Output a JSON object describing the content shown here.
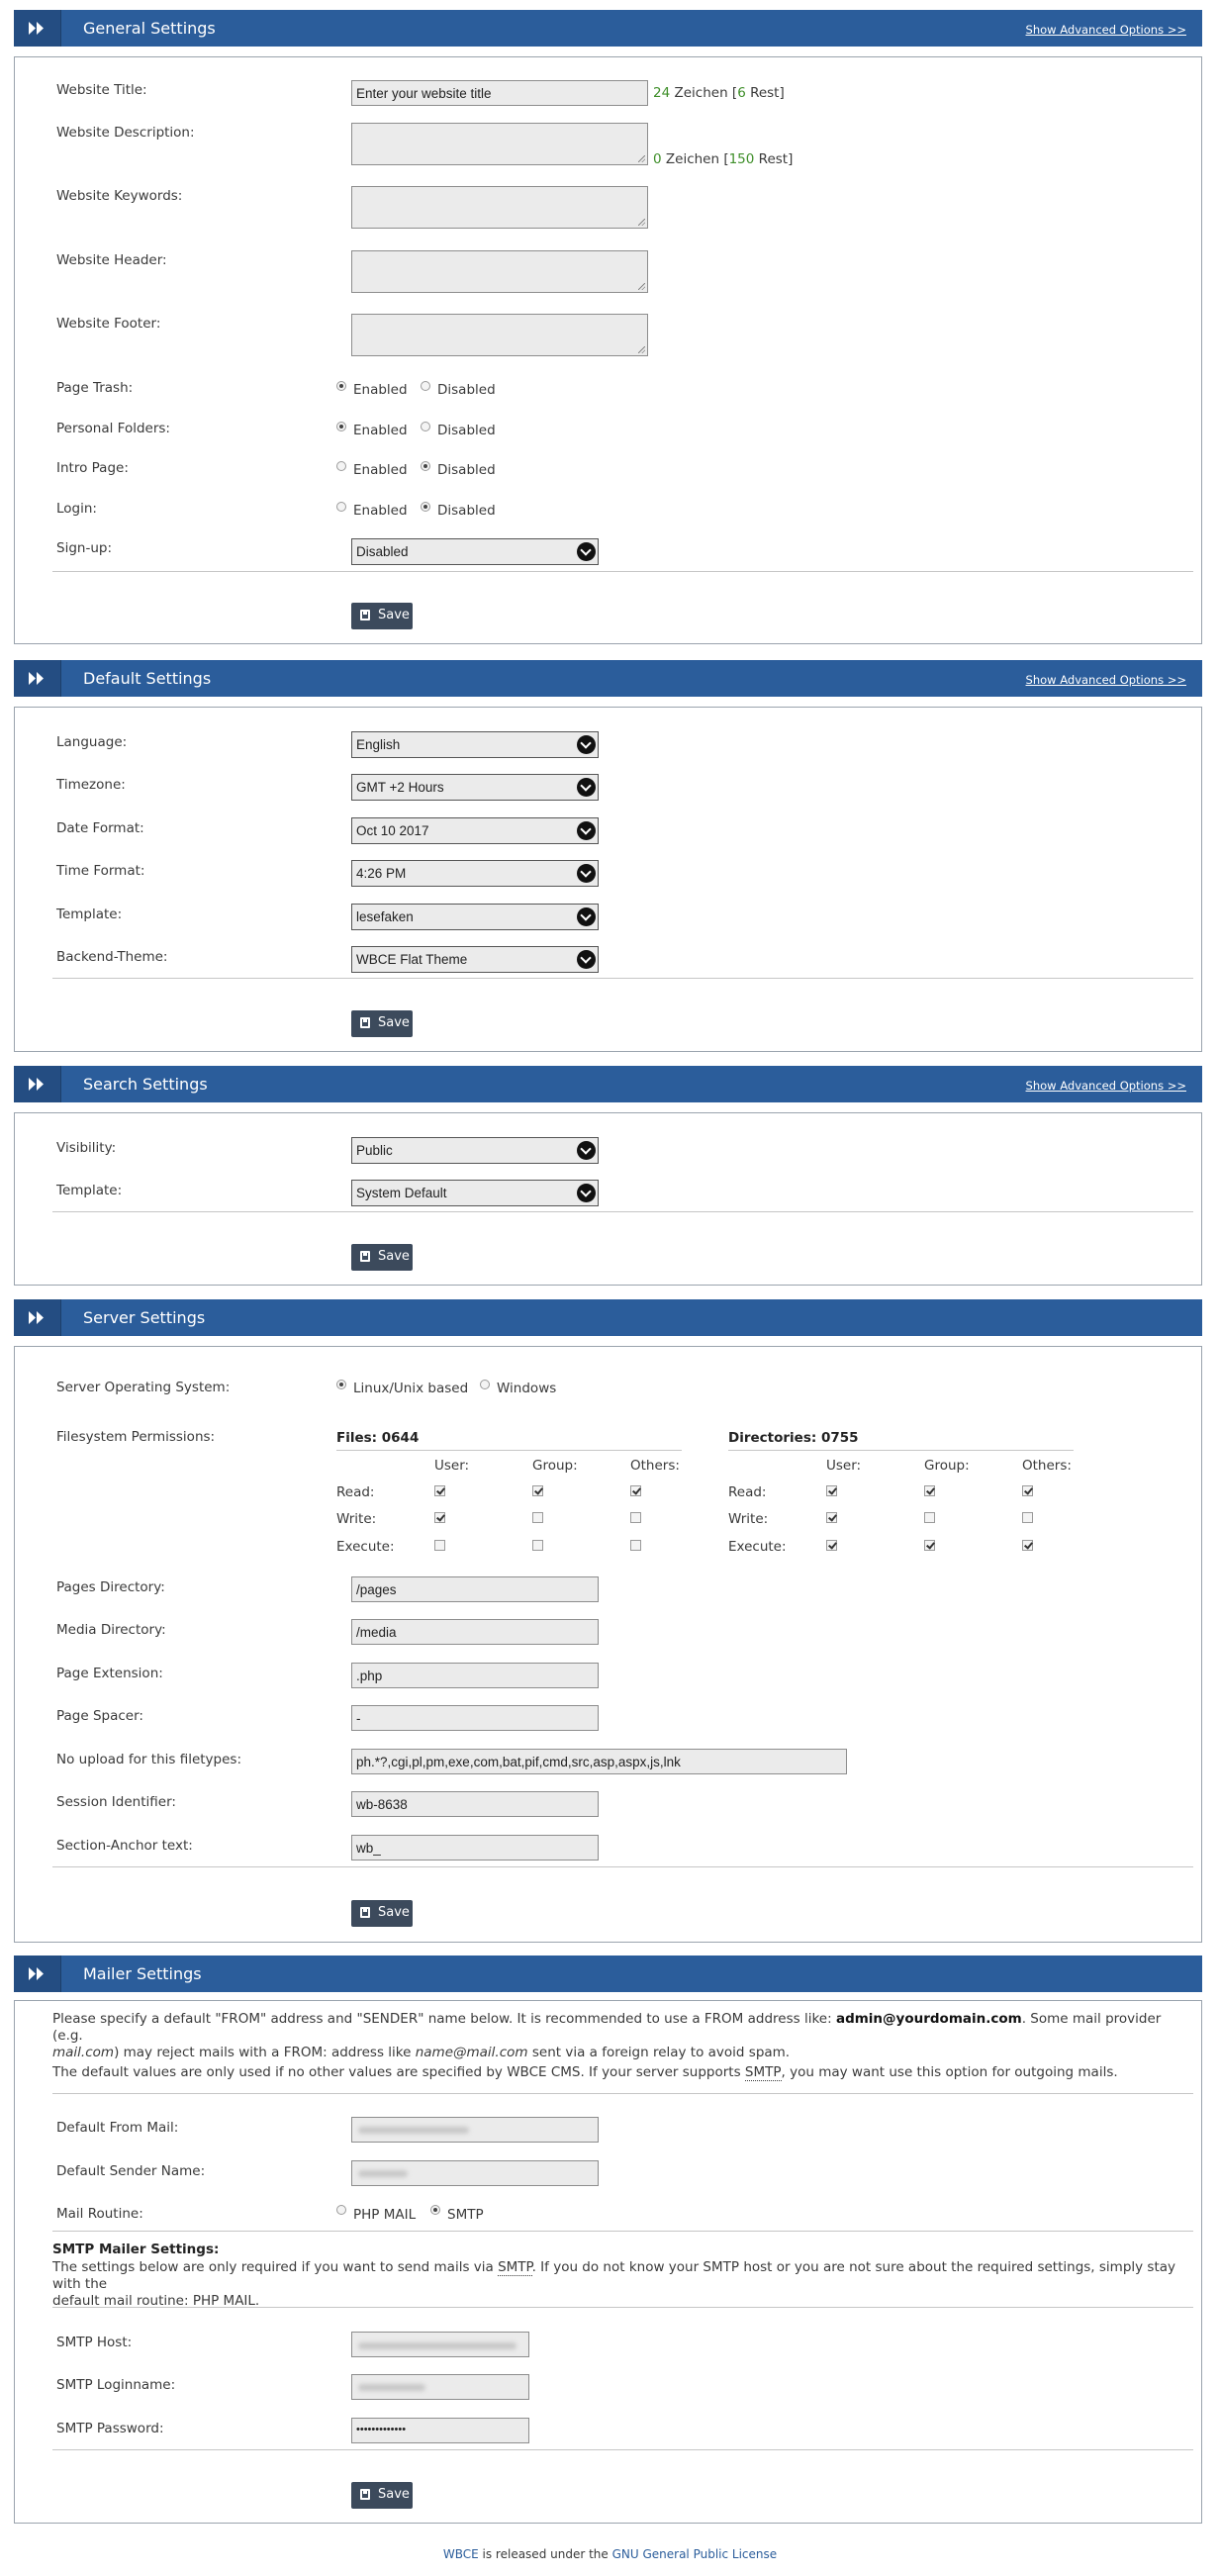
{
  "advanced_link": "Show Advanced Options >>",
  "save_label": "Save",
  "general": {
    "title": "General Settings",
    "website_title_label": "Website Title:",
    "website_title_value": "Enter your website title",
    "title_count": "24",
    "title_count_word": " Zeichen [",
    "title_rest": "6",
    "title_rest_word": " Rest]",
    "description_label": "Website Description:",
    "desc_count": "0",
    "desc_count_word": " Zeichen [",
    "desc_rest": "150",
    "desc_rest_word": " Rest]",
    "keywords_label": "Website Keywords:",
    "header_label": "Website Header:",
    "footer_label": "Website Footer:",
    "page_trash_label": "Page Trash:",
    "personal_folders_label": "Personal Folders:",
    "intro_page_label": "Intro Page:",
    "login_label": "Login:",
    "signup_label": "Sign-up:",
    "signup_value": "Disabled",
    "enabled": "Enabled",
    "disabled": "Disabled"
  },
  "default": {
    "title": "Default Settings",
    "language_label": "Language:",
    "language_value": "English",
    "timezone_label": "Timezone:",
    "timezone_value": "GMT +2 Hours",
    "date_format_label": "Date Format:",
    "date_format_value": "Oct 10 2017",
    "time_format_label": "Time Format:",
    "time_format_value": "4:26 PM",
    "template_label": "Template:",
    "template_value": "lesefaken",
    "backend_theme_label": "Backend-Theme:",
    "backend_theme_value": "WBCE Flat Theme"
  },
  "search": {
    "title": "Search Settings",
    "visibility_label": "Visibility:",
    "visibility_value": "Public",
    "template_label": "Template:",
    "template_value": "System Default"
  },
  "server": {
    "title": "Server Settings",
    "os_label": "Server Operating System:",
    "os_linux": "Linux/Unix based",
    "os_windows": "Windows",
    "fs_label": "Filesystem Permissions:",
    "files_header": "Files: 0644",
    "dirs_header": "Directories: 0755",
    "col_user": "User:",
    "col_group": "Group:",
    "col_others": "Others:",
    "row_read": "Read:",
    "row_write": "Write:",
    "row_execute": "Execute:",
    "pages_dir_label": "Pages Directory:",
    "pages_dir_value": "/pages",
    "media_dir_label": "Media Directory:",
    "media_dir_value": "/media",
    "page_ext_label": "Page Extension:",
    "page_ext_value": ".php",
    "page_spacer_label": "Page Spacer:",
    "page_spacer_value": "-",
    "no_upload_label": "No upload for this filetypes:",
    "no_upload_value": "ph.*?,cgi,pl,pm,exe,com,bat,pif,cmd,src,asp,aspx,js,lnk",
    "session_label": "Session Identifier:",
    "session_value": "wb-8638",
    "anchor_label": "Section-Anchor text:",
    "anchor_value": "wb_"
  },
  "mailer": {
    "title": "Mailer Settings",
    "intro_1a": "Please specify a default \"FROM\" address and \"SENDER\" name below. It is recommended to use a FROM address like: ",
    "intro_1b": "admin@yourdomain.com",
    "intro_1c": ". Some mail provider (e.g.",
    "intro_2a": "mail.com",
    "intro_2b": ") may reject mails with a FROM: address like ",
    "intro_2c": "name@mail.com",
    "intro_2d": " sent via a foreign relay to avoid spam.",
    "intro_3a": "The default values are only used if no other values are specified by WBCE CMS. If your server supports ",
    "intro_3b": "SMTP",
    "intro_3c": ", you may want use this option for outgoing mails.",
    "from_mail_label": "Default From Mail:",
    "sender_name_label": "Default Sender Name:",
    "routine_label": "Mail Routine:",
    "routine_php": "PHP MAIL",
    "routine_smtp": "SMTP",
    "smtp_heading": "SMTP Mailer Settings:",
    "smtp_desc_1a": "The settings below are only required if you want to send mails via ",
    "smtp_desc_1b": "SMTP",
    "smtp_desc_1c": ". If you do not know your SMTP host or you are not sure about the required settings, simply stay with the",
    "smtp_desc_2": "default mail routine: PHP MAIL.",
    "smtp_host_label": "SMTP Host:",
    "smtp_login_label": "SMTP Loginname:",
    "smtp_password_label": "SMTP Password:",
    "smtp_password_value": "•••••••••••••"
  },
  "footer": {
    "brand": "WBCE",
    "mid": " is released under the ",
    "license": "GNU General Public License"
  },
  "permissions": {
    "files": {
      "read": [
        true,
        true,
        true
      ],
      "write": [
        true,
        false,
        false
      ],
      "execute": [
        false,
        false,
        false
      ]
    },
    "dirs": {
      "read": [
        true,
        true,
        true
      ],
      "write": [
        true,
        false,
        false
      ],
      "execute": [
        true,
        true,
        true
      ]
    }
  },
  "colors": {
    "header": "#2b5d9b",
    "save": "#3c4a5c",
    "count_green": "#3f8f2a"
  }
}
